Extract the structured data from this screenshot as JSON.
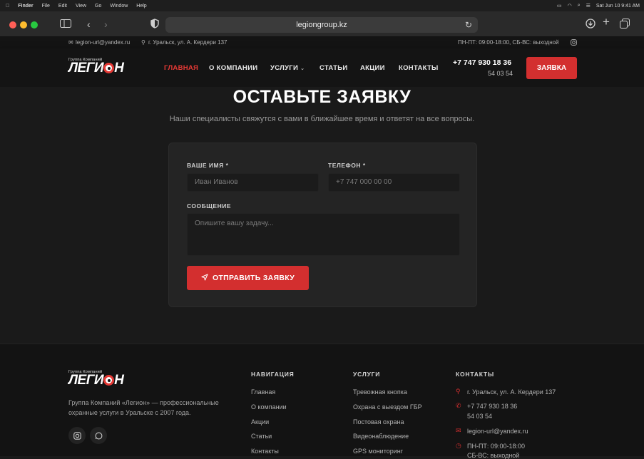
{
  "os": {
    "menu": [
      "Finder",
      "File",
      "Edit",
      "View",
      "Go",
      "Window",
      "Help"
    ],
    "clock": "Sat Jun 10  9:41 AM"
  },
  "browser": {
    "url": "legiongroup.kz"
  },
  "topbar": {
    "email": "legion-url@yandex.ru",
    "address": "г. Уральск, ул. А. Кердери 137",
    "hours": "ПН-ПТ: 09:00-18:00, СБ-ВС: выходной"
  },
  "header": {
    "logo_small": "Группа Компаний",
    "logo_big_1": "ЛЕГИ",
    "logo_big_2": "Н",
    "nav": [
      "ГЛАВНАЯ",
      "О КОМПАНИИ",
      "УСЛУГИ",
      "СТАТЬИ",
      "АКЦИИ",
      "КОНТАКТЫ"
    ],
    "phone_main": "+7 747 930 18 36",
    "phone_sub": "54 03 54",
    "cta": "ЗАЯВКА"
  },
  "main": {
    "title": "ОСТАВЬТЕ ЗАЯВКУ",
    "subtitle": "Наши специалисты свяжутся с вами в ближайшее время и ответят на все вопросы.",
    "form": {
      "name_label": "ВАШЕ ИМЯ *",
      "name_placeholder": "Иван Иванов",
      "phone_label": "ТЕЛЕФОН *",
      "phone_placeholder": "+7 747 000 00 00",
      "message_label": "СООБЩЕНИЕ",
      "message_placeholder": "Опишите вашу задачу...",
      "submit": "ОТПРАВИТЬ ЗАЯВКУ"
    }
  },
  "footer": {
    "description": "Группа Компаний «Легион» — профессиональные охранные услуги в Уральске с 2007 года.",
    "nav_title": "НАВИГАЦИЯ",
    "nav_links": [
      "Главная",
      "О компании",
      "Акции",
      "Статьи",
      "Контакты"
    ],
    "services_title": "УСЛУГИ",
    "services_links": [
      "Тревожная кнопка",
      "Охрана с выездом ГБР",
      "Постовая охрана",
      "Видеонаблюдение",
      "GPS мониторинг"
    ],
    "contacts_title": "КОНТАКТЫ",
    "contact_address": "г. Уральск, ул. А. Кердери 137",
    "contact_phone_1": "+7 747 930 18 36",
    "contact_phone_2": "54 03 54",
    "contact_email": "legion-url@yandex.ru",
    "contact_hours_1": "ПН-ПТ: 09:00-18:00",
    "contact_hours_2": "СБ-ВС: выходной"
  },
  "colors": {
    "accent": "#d32f2f",
    "background": "#1a1a1a"
  }
}
